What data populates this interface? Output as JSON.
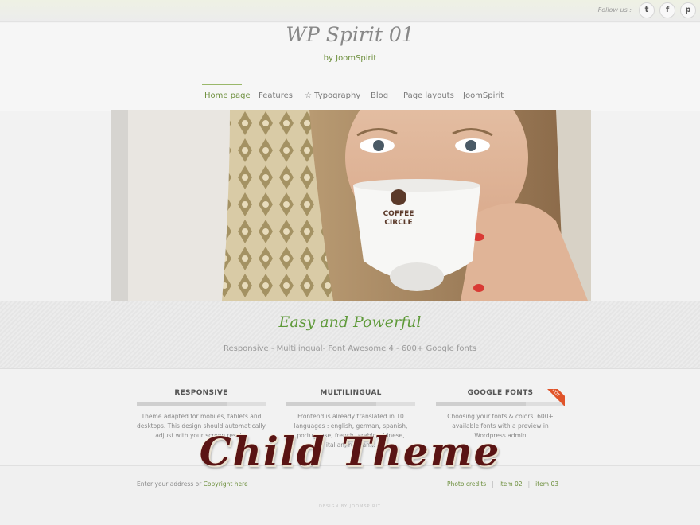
{
  "topbar": {
    "follow_label": "Follow us :",
    "social": [
      {
        "icon": "twitter-icon",
        "glyph": "t"
      },
      {
        "icon": "facebook-icon",
        "glyph": "f"
      },
      {
        "icon": "pinterest-icon",
        "glyph": "p"
      }
    ]
  },
  "header": {
    "logo": "WP Spirit 01",
    "byline": "by JoomSpirit",
    "nav": [
      {
        "label": "Home page",
        "active": true
      },
      {
        "label": "Features",
        "active": false
      },
      {
        "label": "☆ Typography",
        "active": false
      },
      {
        "label": "Blog",
        "active": false
      },
      {
        "label": "Page layouts",
        "active": false
      },
      {
        "label": "JoomSpirit",
        "active": false
      }
    ]
  },
  "hero": {
    "cup_text_1": "COFFEE",
    "cup_text_2": "CIRCLE"
  },
  "band": {
    "tagline": "Easy and Powerful",
    "subtag": "Responsive - Multilingual- Font Awesome 4 - 600+ Google fonts"
  },
  "features": [
    {
      "title": "RESPONSIVE",
      "text": "Theme adapted for mobiles, tablets and desktops. This design should automatically adjust with your screen resol..."
    },
    {
      "title": "MULTILINGUAL",
      "text": "Frontend is already translated in 10 languages : english, german, spanish, portuguese, french, arabic, chinese, italian, russian..."
    },
    {
      "title": "GOOGLE FONTS",
      "text": "Choosing your fonts & colors. 600+ available fonts with a preview in Wordpress admin"
    }
  ],
  "hot_badge": "HOT",
  "footer": {
    "left_prefix": "Enter your address or ",
    "left_link": "Copyright here",
    "links": [
      "Photo credits",
      "item 02",
      "item 03"
    ],
    "credit": "DESIGN BY JOOMSPIRIT"
  },
  "overlay": "Child Theme",
  "colors": {
    "accent": "#6d8f3d",
    "tagline": "#5f9a3a",
    "overlay": "#5a1414"
  }
}
